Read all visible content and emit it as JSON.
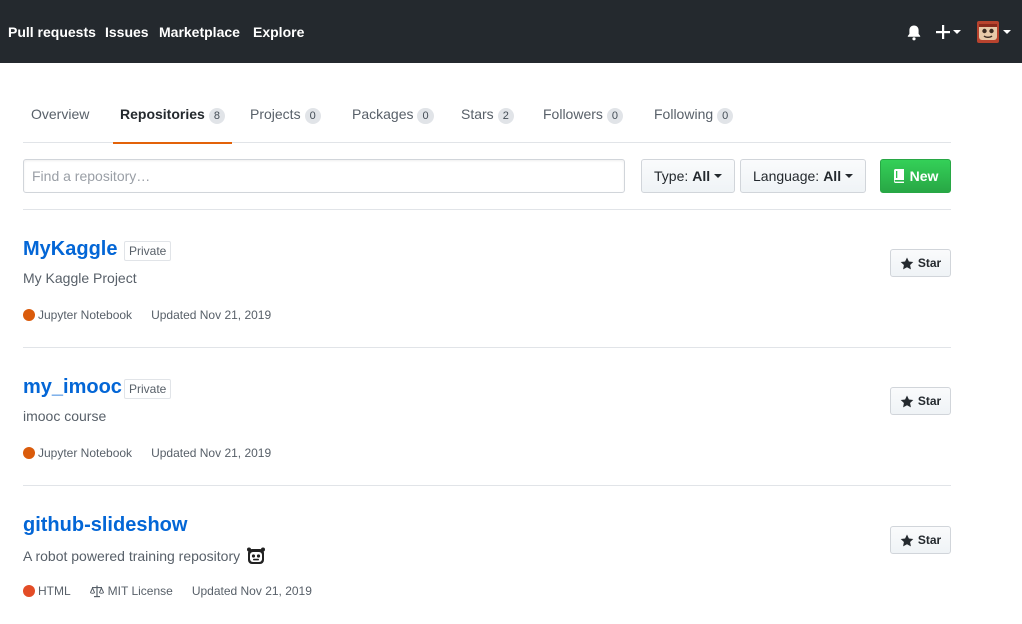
{
  "header": {
    "nav": [
      "Pull requests",
      "Issues",
      "Marketplace",
      "Explore"
    ],
    "icons": {
      "notifications": "bell-icon",
      "create": "plus-icon",
      "avatar": "avatar-image"
    }
  },
  "tabs": [
    {
      "label": "Overview",
      "count": null
    },
    {
      "label": "Repositories",
      "count": "8",
      "active": true
    },
    {
      "label": "Projects",
      "count": "0"
    },
    {
      "label": "Packages",
      "count": "0"
    },
    {
      "label": "Stars",
      "count": "2"
    },
    {
      "label": "Followers",
      "count": "0"
    },
    {
      "label": "Following",
      "count": "0"
    }
  ],
  "filter": {
    "search_placeholder": "Find a repository…",
    "type_label": "Type:",
    "type_value": "All",
    "language_label": "Language:",
    "language_value": "All",
    "new_label": "New"
  },
  "repos": [
    {
      "name": "MyKaggle",
      "visibility": "Private",
      "description": "My Kaggle Project",
      "language": "Jupyter Notebook",
      "language_color": "#DA5B0B",
      "updated": "Updated Nov 21, 2019",
      "star_label": "Star"
    },
    {
      "name": "my_imooc",
      "visibility": "Private",
      "description": "imooc course",
      "language": "Jupyter Notebook",
      "language_color": "#DA5B0B",
      "updated": "Updated Nov 21, 2019",
      "star_label": "Star"
    },
    {
      "name": "github-slideshow",
      "description": "A robot powered training repository",
      "description_emoji": "robot-face-icon",
      "language": "HTML",
      "language_color": "#e34c26",
      "license": "MIT License",
      "updated": "Updated Nov 21, 2019",
      "star_label": "Star"
    }
  ],
  "colors": {
    "header_bg": "#24292e",
    "link": "#0366d6",
    "tab_underline": "#e36209",
    "new_button": "#28a745"
  }
}
